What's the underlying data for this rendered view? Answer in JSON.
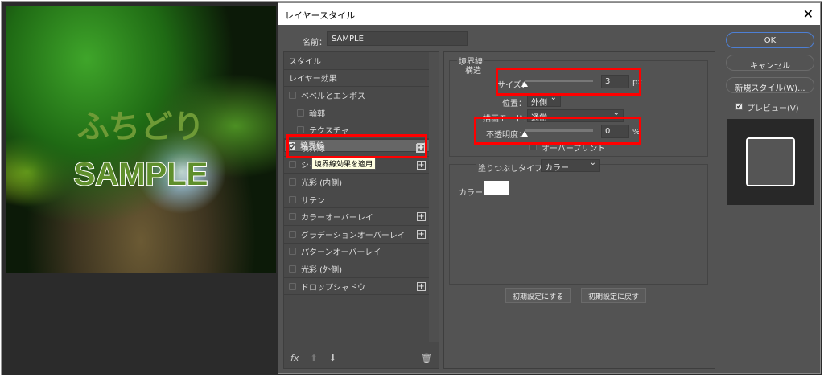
{
  "canvas": {
    "heading_text": "ふちどり",
    "sample_text": "SAMPLE"
  },
  "dialog": {
    "title": "レイヤースタイル",
    "name_label": "名前：",
    "name_value": "SAMPLE"
  },
  "list": {
    "items": [
      {
        "label": "スタイル",
        "checkbox": false,
        "checked": false,
        "plus": false,
        "indent": false
      },
      {
        "label": "レイヤー効果",
        "checkbox": false,
        "checked": false,
        "plus": false,
        "indent": false
      },
      {
        "label": "ベベルとエンボス",
        "checkbox": true,
        "checked": false,
        "plus": false,
        "indent": false
      },
      {
        "label": "輪郭",
        "checkbox": true,
        "checked": false,
        "plus": false,
        "indent": true
      },
      {
        "label": "テクスチャ",
        "checkbox": true,
        "checked": false,
        "plus": false,
        "indent": true
      },
      {
        "label": "境界線",
        "checkbox": true,
        "checked": true,
        "plus": true,
        "indent": false,
        "selected": true
      },
      {
        "label": "境界線",
        "checkbox": true,
        "checked": true,
        "plus": true,
        "indent": false
      },
      {
        "label": "シャドウ (内側)",
        "checkbox": true,
        "checked": false,
        "plus": true,
        "indent": false
      },
      {
        "label": "光彩 (内側)",
        "checkbox": true,
        "checked": false,
        "plus": false,
        "indent": false
      },
      {
        "label": "サテン",
        "checkbox": true,
        "checked": false,
        "plus": false,
        "indent": false
      },
      {
        "label": "カラーオーバーレイ",
        "checkbox": true,
        "checked": false,
        "plus": true,
        "indent": false
      },
      {
        "label": "グラデーションオーバーレイ",
        "checkbox": true,
        "checked": false,
        "plus": true,
        "indent": false
      },
      {
        "label": "パターンオーバーレイ",
        "checkbox": true,
        "checked": false,
        "plus": false,
        "indent": false
      },
      {
        "label": "光彩 (外側)",
        "checkbox": true,
        "checked": false,
        "plus": false,
        "indent": false
      },
      {
        "label": "ドロップシャドウ",
        "checkbox": true,
        "checked": false,
        "plus": true,
        "indent": false
      }
    ],
    "tooltip": "境界線効果を適用",
    "fx": "fx",
    "up": "⬆",
    "down": "⬇",
    "trash": "🗑"
  },
  "stroke": {
    "section_title": "境界線",
    "structure_title": "構造",
    "size_label": "サイズ：",
    "size_value": "3",
    "size_unit": "px",
    "size_fraction": 0.0,
    "position_label": "位置：",
    "position_value": "外側",
    "blend_label": "描画モード：",
    "blend_value": "通常",
    "opacity_label": "不透明度：",
    "opacity_value": "0",
    "opacity_unit": "%",
    "opacity_fraction": 0.0,
    "overprint_label": "オーバープリント",
    "fill_type_label": "塗りつぶしタイプ：",
    "fill_type_value": "カラー",
    "color_label": "カラー：",
    "color_value": "#ffffff",
    "make_default": "初期設定にする",
    "reset_default": "初期設定に戻す"
  },
  "buttons": {
    "ok": "OK",
    "cancel": "キャンセル",
    "new_style": "新規スタイル(W)...",
    "preview_label": "プレビュー(V)",
    "preview_checked": true
  },
  "colors": {
    "highlight": "#ff0000",
    "dialog_bg": "#535353"
  }
}
